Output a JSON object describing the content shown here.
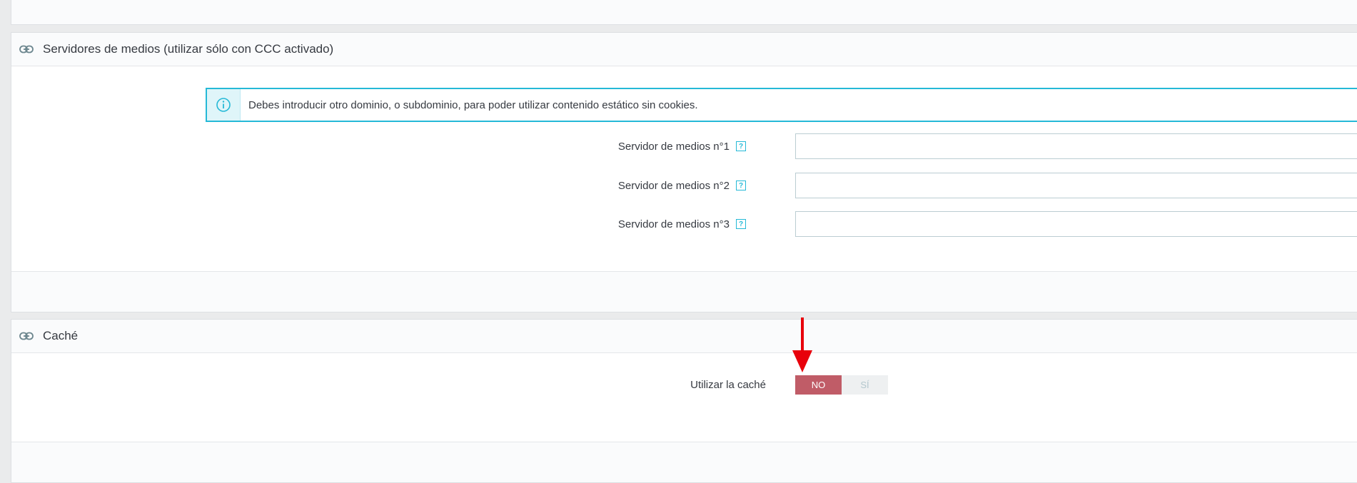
{
  "media_panel": {
    "title": "Servidores de medios (utilizar sólo con CCC activado)",
    "icon": "link-icon",
    "alert": {
      "icon": "info-icon",
      "text": "Debes introducir otro dominio, o subdominio, para poder utilizar contenido estático sin cookies."
    },
    "fields": [
      {
        "label": "Servidor de medios n°1",
        "help": "?",
        "value": ""
      },
      {
        "label": "Servidor de medios n°2",
        "help": "?",
        "value": ""
      },
      {
        "label": "Servidor de medios n°3",
        "help": "?",
        "value": ""
      }
    ]
  },
  "cache_panel": {
    "title": "Caché",
    "icon": "link-icon",
    "use_cache": {
      "label": "Utilizar la caché",
      "options": [
        "NO",
        "SÍ"
      ],
      "selected": "NO"
    }
  },
  "colors": {
    "accent": "#25b9d7",
    "toggle_active": "#c05c67",
    "annotation_arrow": "#e8000b"
  }
}
